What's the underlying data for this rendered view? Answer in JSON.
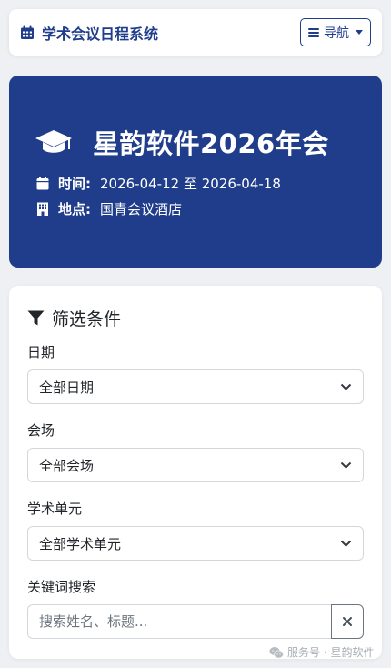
{
  "navbar": {
    "brand_icon": "calendar-icon",
    "brand_text": "学术会议日程系统",
    "nav_button_label": "导航",
    "nav_button_icon": "hamburger-icon"
  },
  "hero": {
    "icon": "graduation-cap-icon",
    "title": "星韵软件2026年会",
    "time_label": "时间:",
    "time_value": "2026-04-12 至 2026-04-18",
    "place_label": "地点:",
    "place_value": "国青会议酒店",
    "background_color": "#1f3d8a"
  },
  "filters": {
    "title": "筛选条件",
    "title_icon": "filter-icon",
    "date_label": "日期",
    "date_selected": "全部日期",
    "venue_label": "会场",
    "venue_selected": "全部会场",
    "unit_label": "学术单元",
    "unit_selected": "全部学术单元",
    "keyword_label": "关键词搜索",
    "keyword_placeholder": "搜索姓名、标题...",
    "keyword_value": "",
    "clear_icon": "close-icon"
  },
  "watermark": {
    "icon": "wechat-icon",
    "text": "服务号 · 星韵软件"
  }
}
